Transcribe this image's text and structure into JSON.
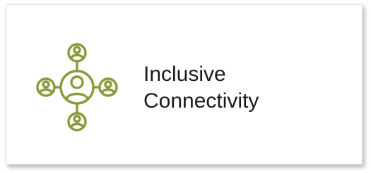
{
  "card": {
    "title_line1": "Inclusive",
    "title_line2": "Connectivity"
  },
  "icon": {
    "name": "network-people-icon",
    "color": "#8a9a3a"
  }
}
